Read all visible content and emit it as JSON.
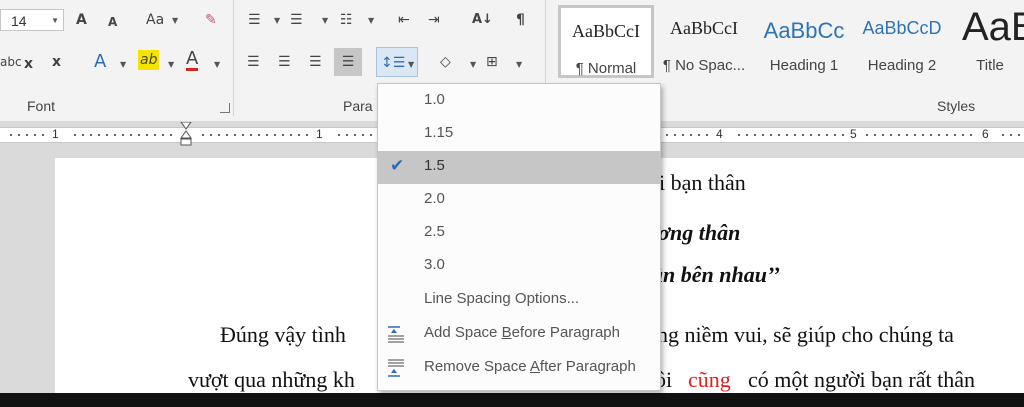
{
  "ribbon": {
    "font_size": "14",
    "font_group_label": "Font",
    "paragraph_group_label": "Para",
    "styles_group_label": "Styles",
    "icons": {
      "grow_font": "A",
      "shrink_font": "A",
      "change_case": "Aa",
      "subscript": "x",
      "superscript": "x",
      "text_effects": "A",
      "highlight": "ab",
      "font_color": "A",
      "pilcrow": "¶",
      "strike": "abc"
    }
  },
  "styles": [
    {
      "preview": "AaBbCcI",
      "name": "¶ Normal",
      "kind": "normal",
      "active": true
    },
    {
      "preview": "AaBbCcI",
      "name": "¶ No Spac...",
      "kind": "normal",
      "active": false
    },
    {
      "preview": "AaBbCc",
      "name": "Heading 1",
      "kind": "heading",
      "active": false
    },
    {
      "preview": "AaBbCcD",
      "name": "Heading 2",
      "kind": "heading",
      "active": false
    },
    {
      "preview": "AaB",
      "name": "Title",
      "kind": "title",
      "active": false
    }
  ],
  "ruler": {
    "numbers": [
      "1",
      "1",
      "4",
      "5",
      "6"
    ]
  },
  "line_spacing_menu": {
    "options": [
      {
        "label": "1.0",
        "checked": false
      },
      {
        "label": "1.15",
        "checked": false
      },
      {
        "label": "1.5",
        "checked": true
      },
      {
        "label": "2.0",
        "checked": false
      },
      {
        "label": "2.5",
        "checked": false
      },
      {
        "label": "3.0",
        "checked": false
      }
    ],
    "more_options": "Line Spacing Options...",
    "add_space_before": {
      "pre": "Add Space ",
      "key": "B",
      "post": "efore Paragraph"
    },
    "remove_space_after": {
      "pre": "Remove Space ",
      "key": "A",
      "post": "fter Paragraph"
    }
  },
  "document": {
    "line1": "i bạn thân",
    "line2": "ương thân",
    "line3": "ần bên nhau’’",
    "line4_left": "Đúng vậy tình",
    "line4_right": "ng niềm vui, sẽ giúp cho chúng ta",
    "line5_a": "vượt qua những kh",
    "line5_b": "ôi",
    "line5_red": "cũng",
    "line5_c": "có một người bạn rất thân"
  },
  "colors": {
    "accent": "#2b6cb8",
    "selected": "#c6c6c6",
    "red_text": "#d8231f"
  }
}
